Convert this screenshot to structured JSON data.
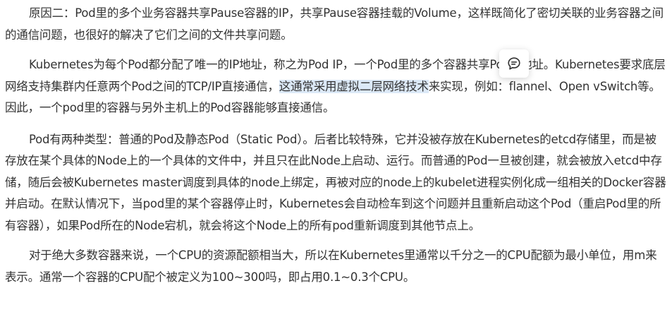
{
  "article": {
    "paragraph1": {
      "text": "原因二：Pod里的多个业务容器共享Pause容器的IP，共享Pause容器挂载的Volume，这样既简化了密切关联的业务容器之间的通信问题，也很好的解决了它们之间的文件共享问题。"
    },
    "paragraph2": {
      "before": "Kubernetes为每个Pod都分配了唯一的IP地址，称之为Pod IP，一个Pod里的多个容器共享PodIP地址。Kubernetes要求底层网络支持集群内任意两个Pod之间的TCP/IP直接通信，",
      "highlighted": "这通常采用虚拟二层网络技术",
      "after": "来实现，例如：flannel、Open vSwitch等。因此，一个pod里的容器与另外主机上的Pod容器能够直接通信。"
    },
    "paragraph3": {
      "text": "Pod有两种类型：普通的Pod及静态Pod（Static Pod）。后者比较特殊，它并没被存放在Kubernetes的etcd存储里，而是被存放在某个具体的Node上的一个具体的文件中，并且只在此Node上启动、运行。而普通的Pod一旦被创建，就会被放入etcd中存储，随后会被Kubernetes master调度到具体的node上绑定，再被对应的node上的kubelet进程实例化成一组相关的Docker容器并启动。在默认情况下，当pod里的某个容器停止时，Kubernetes会自动检车到这个问题并且重新启动这个Pod（重启Pod里的所有容器），如果Pod所在的Node宕机，就会将这个Node上的所有pod重新调度到其他节点上。"
    },
    "paragraph4": {
      "text": "对于绝大多数容器来说，一个CPU的资源配额相当大，所以在Kubernetes里通常以千分之一的CPU配额为最小单位，用m来表示。通常一个容器的CPU配个被定义为100~300吗，即占用0.1~0.3个CPU。"
    }
  },
  "floating_toolbar": {
    "icon": "comment-icon"
  },
  "colors": {
    "text": "#333333",
    "highlight": "#dce9f7"
  }
}
